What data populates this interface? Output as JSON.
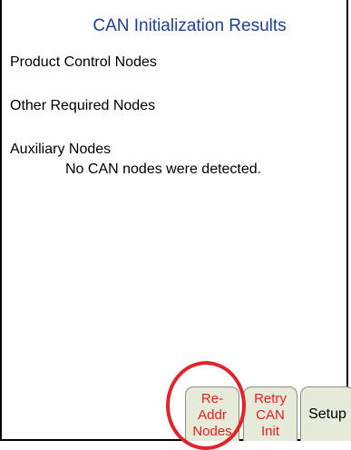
{
  "screen": {
    "title": "CAN Initialization Results"
  },
  "sections": {
    "product_control": "Product Control Nodes",
    "other_required": "Other Required Nodes",
    "auxiliary": "Auxiliary Nodes",
    "auxiliary_message": "No CAN nodes were detected."
  },
  "buttons": {
    "readdr": [
      "Re-",
      "Addr",
      "Nodes"
    ],
    "retry": [
      "Retry",
      "CAN",
      "Init"
    ],
    "setup": "Setup"
  },
  "colors": {
    "title": "#1f3f8f",
    "button_bg": "#e6ead8",
    "button_text_red": "#e02020",
    "highlight_circle": "#e0242a"
  }
}
